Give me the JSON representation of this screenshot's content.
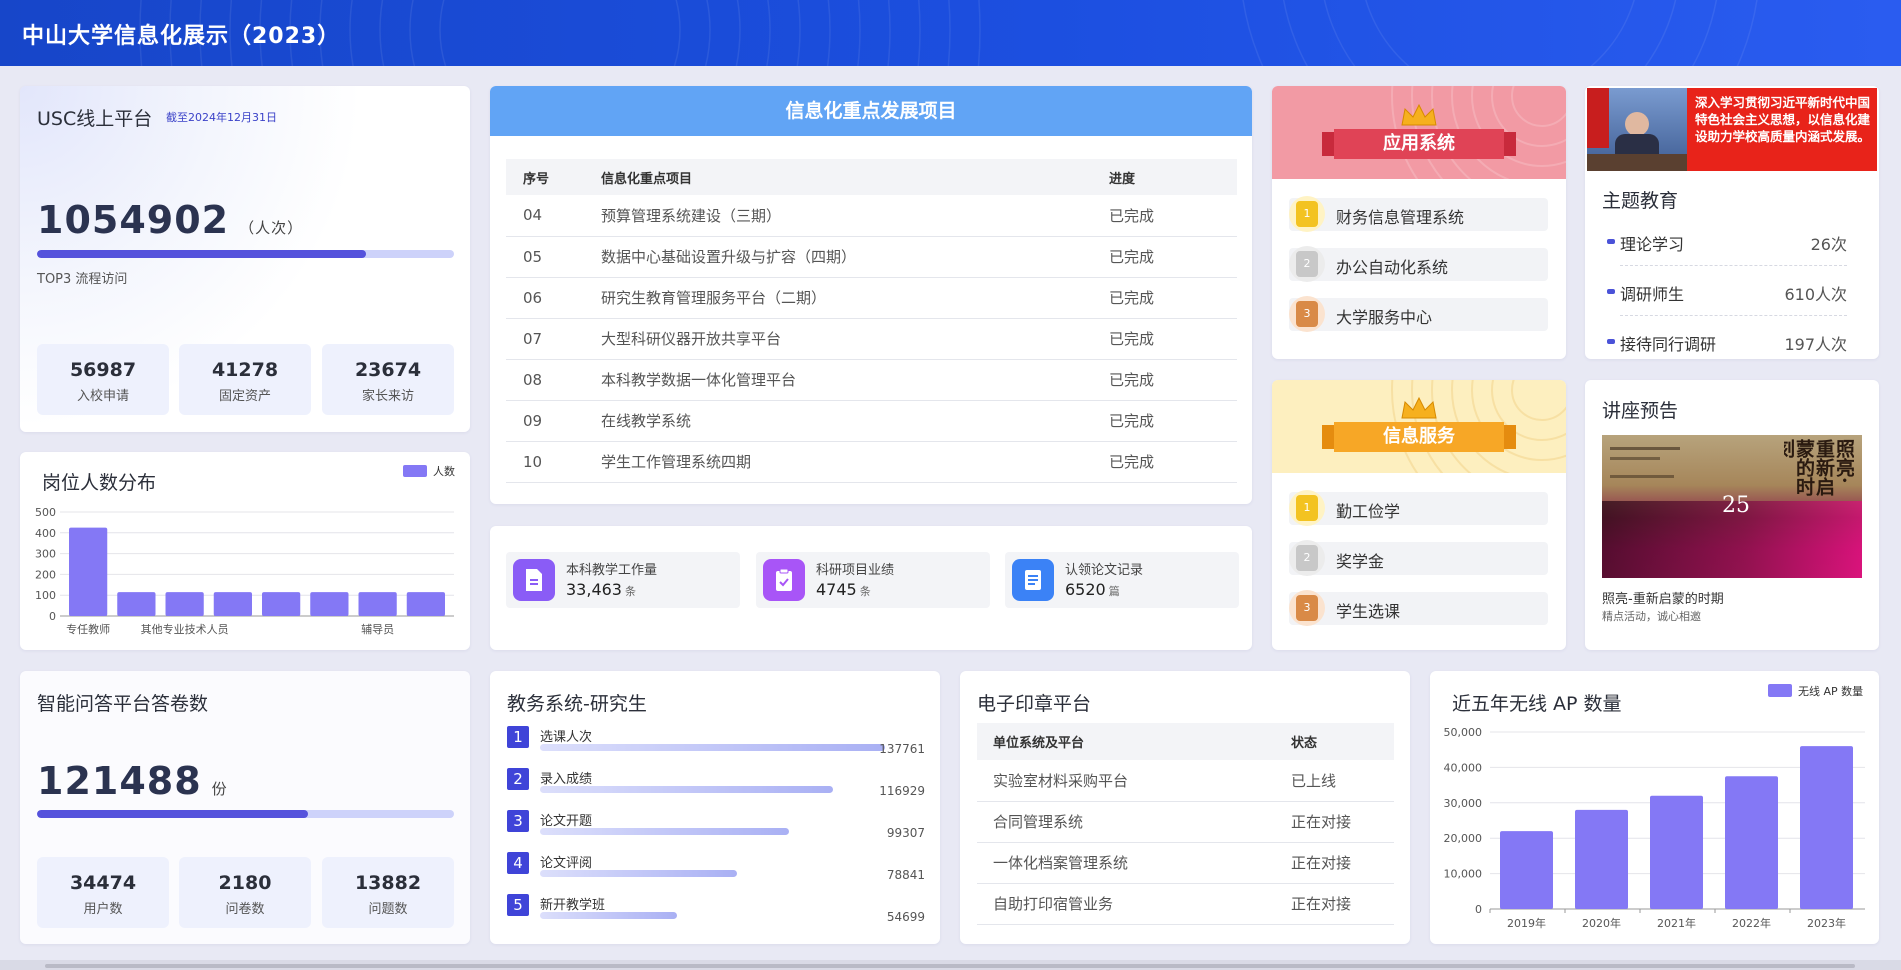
{
  "header": {
    "title": "中山大学信息化展示（2023）"
  },
  "usc": {
    "title": "USC线上平台",
    "note": "截至2024年12月31日",
    "value": "1054902",
    "unit": "（人次）",
    "progress": 0.79,
    "caption": "TOP3 流程访问",
    "stats": [
      {
        "value": "56987",
        "label": "入校申请"
      },
      {
        "value": "41278",
        "label": "固定资产"
      },
      {
        "value": "23674",
        "label": "家长来访"
      }
    ]
  },
  "positions": {
    "title": "岗位人数分布",
    "chart_data": {
      "type": "bar",
      "title": "岗位人数分布",
      "series": [
        {
          "name": "人数",
          "values": [
            425,
            115,
            115,
            115,
            115,
            115,
            115,
            115
          ]
        }
      ],
      "categories": [
        "专任教师",
        "",
        "其他专业技术人员",
        "",
        "",
        "",
        "辅导员",
        ""
      ],
      "tick_labels": [
        "专任教师",
        "其他专业技术人员",
        "辅导员"
      ],
      "yticks": [
        "0",
        "100",
        "200",
        "300",
        "400",
        "500"
      ],
      "ylim": [
        0,
        500
      ],
      "grid": true,
      "legend": "top-right",
      "color": "#8478f5"
    }
  },
  "projects": {
    "title": "信息化重点发展项目",
    "columns": [
      "序号",
      "信息化重点项目",
      "进度"
    ],
    "rows": [
      [
        "04",
        "预算管理系统建设（三期）",
        "已完成"
      ],
      [
        "05",
        "数据中心基础设置升级与扩容（四期）",
        "已完成"
      ],
      [
        "06",
        "研究生教育管理服务平台（二期）",
        "已完成"
      ],
      [
        "07",
        "大型科研仪器开放共享平台",
        "已完成"
      ],
      [
        "08",
        "本科教学数据一体化管理平台",
        "已完成"
      ],
      [
        "09",
        "在线教学系统",
        "已完成"
      ],
      [
        "10",
        "学生工作管理系统四期",
        "已完成"
      ]
    ]
  },
  "kpis": [
    {
      "label": "本科教学工作量",
      "value": "33,463",
      "unit": "条",
      "icon": "document-icon",
      "color": "#8a5cf6"
    },
    {
      "label": "科研项目业绩",
      "value": "4745",
      "unit": "条",
      "icon": "clipboard-check-icon",
      "color": "#a855f7"
    },
    {
      "label": "认领论文记录",
      "value": "6520",
      "unit": "篇",
      "icon": "paper-icon",
      "color": "#3b82f6"
    }
  ],
  "apps": {
    "title": "应用系统",
    "items": [
      "财务信息管理系统",
      "办公自动化系统",
      "大学服务中心"
    ]
  },
  "services": {
    "title": "信息服务",
    "items": [
      "勤工俭学",
      "奖学金",
      "学生选课"
    ]
  },
  "theme": {
    "banner_text": "深入学习贯彻习近平新时代中国特色社会主义思想，以信息化建设助力学校高质量内涵式发展。",
    "title": "主题教育",
    "rows": [
      {
        "label": "理论学习",
        "value": "26次"
      },
      {
        "label": "调研师生",
        "value": "610人次"
      },
      {
        "label": "接待同行调研",
        "value": "197人次"
      }
    ]
  },
  "lecture": {
    "title": "讲座预告",
    "poster_heading": "照亮·重新启蒙的时刻",
    "caption": "照亮-重新启蒙的时期",
    "sub": "精点活动，诚心相邀"
  },
  "qa": {
    "title": "智能问答平台答卷数",
    "value": "121488",
    "unit": "份",
    "progress": 0.65,
    "stats": [
      {
        "value": "34474",
        "label": "用户数"
      },
      {
        "value": "2180",
        "label": "问卷数"
      },
      {
        "value": "13882",
        "label": "问题数"
      }
    ]
  },
  "grad": {
    "title": "教务系统-研究生",
    "max": 137761,
    "items": [
      {
        "no": "1",
        "label": "选课人次",
        "value": 137761
      },
      {
        "no": "2",
        "label": "录入成绩",
        "value": 116929
      },
      {
        "no": "3",
        "label": "论文开题",
        "value": 99307
      },
      {
        "no": "4",
        "label": "论文评阅",
        "value": 78841
      },
      {
        "no": "5",
        "label": "新开教学班",
        "value": 54699
      }
    ]
  },
  "seal": {
    "title": "电子印章平台",
    "columns": [
      "单位系统及平台",
      "状态"
    ],
    "rows": [
      [
        "实验室材料采购平台",
        "已上线"
      ],
      [
        "合同管理系统",
        "正在对接"
      ],
      [
        "一体化档案管理系统",
        "正在对接"
      ],
      [
        "自助打印宿管业务",
        "正在对接"
      ]
    ]
  },
  "ap": {
    "title": "近五年无线 AP 数量",
    "chart_data": {
      "type": "bar",
      "title": "近五年无线 AP 数量",
      "categories": [
        "2019年",
        "2020年",
        "2021年",
        "2022年",
        "2023年"
      ],
      "series": [
        {
          "name": "无线 AP 数量",
          "values": [
            22000,
            28000,
            32000,
            37500,
            46000
          ]
        }
      ],
      "yticks": [
        "0",
        "10,000",
        "20,000",
        "30,000",
        "40,000",
        "50,000"
      ],
      "ylim": [
        0,
        50000
      ],
      "grid": true,
      "legend": "top-right",
      "color": "#8478f5"
    }
  }
}
